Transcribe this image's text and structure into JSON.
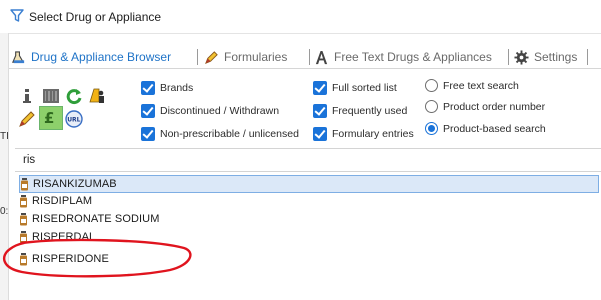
{
  "window": {
    "title": "Select Drug or Appliance",
    "app_icon": "funnel-icon"
  },
  "background_fragments": [
    "TI",
    "0:"
  ],
  "tabs": [
    {
      "label": "Drug & Appliance Browser",
      "icon": "flask-icon",
      "active": true
    },
    {
      "label": "Formularies",
      "icon": "pen-icon",
      "active": false
    },
    {
      "label": "Free Text Drugs & Appliances",
      "icon": "font-a-icon",
      "active": false
    },
    {
      "label": "Settings",
      "icon": "gear-icon",
      "active": false
    }
  ],
  "tool_icons": [
    {
      "name": "info-icon"
    },
    {
      "name": "barcode-icon"
    },
    {
      "name": "refresh-icon"
    },
    {
      "name": "warning-person-icon"
    },
    {
      "name": "pen-icon"
    },
    {
      "name": "pound-icon"
    },
    {
      "name": "url-icon"
    }
  ],
  "checkboxes": [
    {
      "label": "Brands",
      "checked": true
    },
    {
      "label": "Discontinued / Withdrawn",
      "checked": true
    },
    {
      "label": "Non-prescribable / unlicensed",
      "checked": true
    },
    {
      "label": "Full sorted list",
      "checked": true
    },
    {
      "label": "Frequently used",
      "checked": true
    },
    {
      "label": "Formulary entries",
      "checked": true
    }
  ],
  "radios": [
    {
      "label": "Free text search",
      "selected": false
    },
    {
      "label": "Product order number",
      "selected": false
    },
    {
      "label": "Product-based search",
      "selected": true
    }
  ],
  "search": {
    "value": "ris"
  },
  "results": [
    {
      "name": "RISANKIZUMAB",
      "selected": true
    },
    {
      "name": "RISDIPLAM",
      "selected": false
    },
    {
      "name": "RISEDRONATE SODIUM",
      "selected": false
    },
    {
      "name": "RISPERDAL",
      "selected": false
    },
    {
      "name": "RISPERIDONE",
      "selected": false,
      "highlighted": true
    }
  ],
  "colors": {
    "accent": "#1a73d9",
    "active_tab": "#1f73c7",
    "selection": "#dbe8f8",
    "annotation": "#e0141e"
  }
}
